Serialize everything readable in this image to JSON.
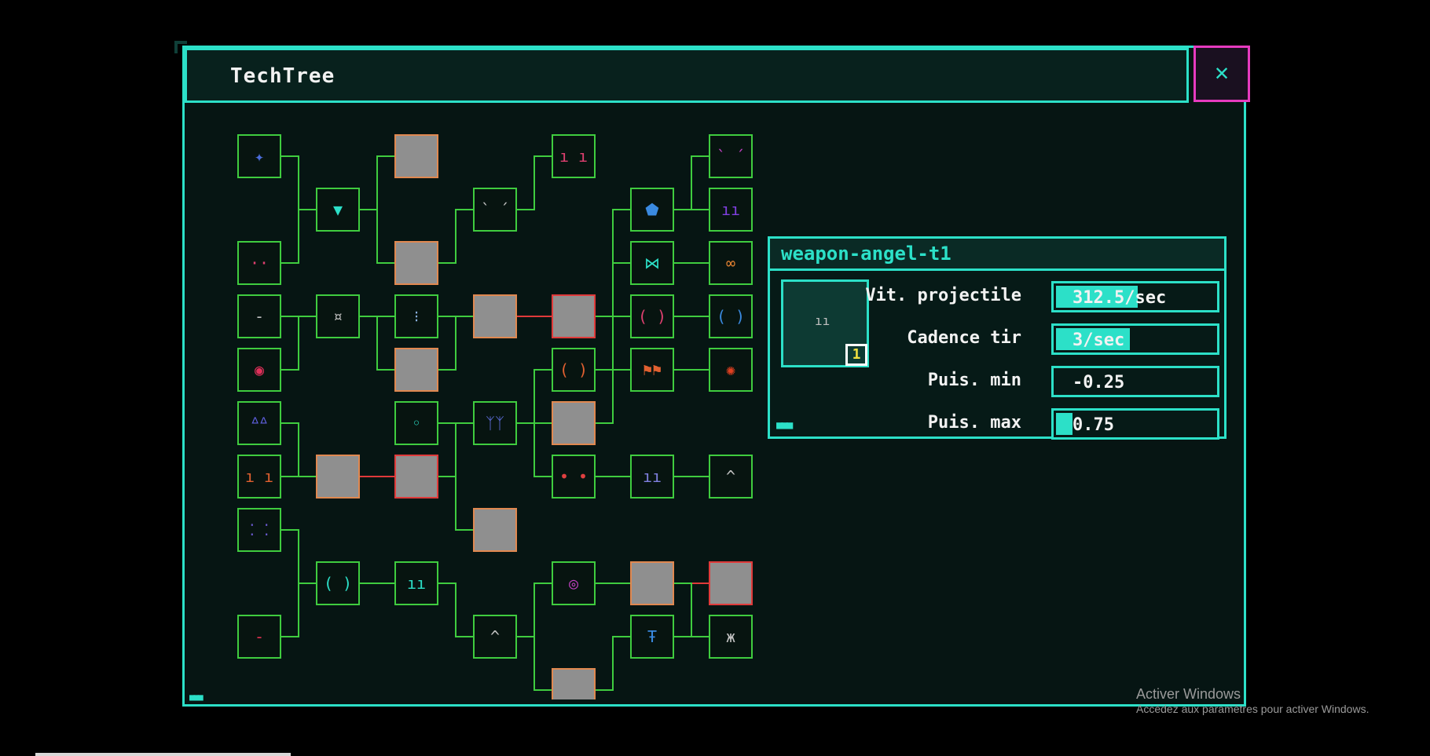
{
  "window": {
    "title": "TechTree",
    "close_label": "✕"
  },
  "info_panel": {
    "title": "weapon-angel-t1",
    "level": "1",
    "icon_glyph": "ıı",
    "stats": [
      {
        "label": "Vit. projectile",
        "value": "312.5/sec",
        "fill": 0.5
      },
      {
        "label": "Cadence tir",
        "value": "3/sec",
        "fill": 0.45
      },
      {
        "label": "Puis. min",
        "value": "-0.25",
        "fill": 0
      },
      {
        "label": "Puis. max",
        "value": "0.75",
        "fill": 0.1
      }
    ]
  },
  "tree_nodes": [
    {
      "id": "n1",
      "col": 0,
      "row": 0,
      "state": "unlocked",
      "glyph": "✦",
      "color": "#4a6cd8"
    },
    {
      "id": "n2",
      "col": 0,
      "row": 2,
      "state": "unlocked",
      "glyph": "··",
      "color": "#e04070"
    },
    {
      "id": "n3",
      "col": 0,
      "row": 3,
      "state": "unlocked",
      "glyph": "-",
      "color": "#c0c0c0"
    },
    {
      "id": "n4",
      "col": 0,
      "row": 4,
      "state": "unlocked",
      "glyph": "◉",
      "color": "#e0305a"
    },
    {
      "id": "n5",
      "col": 0,
      "row": 5,
      "state": "unlocked",
      "glyph": "ᐞᐞ",
      "color": "#6060e0"
    },
    {
      "id": "n6",
      "col": 0,
      "row": 6,
      "state": "unlocked",
      "glyph": "ı ı",
      "color": "#e06030"
    },
    {
      "id": "n7",
      "col": 0,
      "row": 7,
      "state": "unlocked",
      "glyph": "⁚ ⁚",
      "color": "#6a5ad0"
    },
    {
      "id": "n8",
      "col": 0,
      "row": 9,
      "state": "unlocked",
      "glyph": "-",
      "color": "#e03050"
    },
    {
      "id": "n9",
      "col": 1,
      "row": 1,
      "state": "unlocked",
      "glyph": "▼",
      "color": "#2ce0c8"
    },
    {
      "id": "n10",
      "col": 1,
      "row": 3,
      "state": "unlocked",
      "glyph": "¤",
      "color": "#c0c0c0"
    },
    {
      "id": "n11",
      "col": 1,
      "row": 6,
      "state": "locked",
      "glyph": "",
      "color": ""
    },
    {
      "id": "n12",
      "col": 1,
      "row": 8,
      "state": "unlocked",
      "glyph": "( )",
      "color": "#2ce0c8"
    },
    {
      "id": "n13",
      "col": 2,
      "row": 0,
      "state": "locked",
      "glyph": "",
      "color": ""
    },
    {
      "id": "n14",
      "col": 2,
      "row": 2,
      "state": "locked",
      "glyph": "",
      "color": ""
    },
    {
      "id": "n15",
      "col": 2,
      "row": 3,
      "state": "unlocked",
      "glyph": "⁝",
      "color": "#8ab0e0"
    },
    {
      "id": "n16",
      "col": 2,
      "row": 4,
      "state": "locked",
      "glyph": "",
      "color": ""
    },
    {
      "id": "n17",
      "col": 2,
      "row": 5,
      "state": "unlocked",
      "glyph": "◦",
      "color": "#2ce0c8"
    },
    {
      "id": "n18",
      "col": 2,
      "row": 6,
      "state": "locked-red",
      "glyph": "",
      "color": ""
    },
    {
      "id": "n19",
      "col": 2,
      "row": 8,
      "state": "unlocked",
      "glyph": "ıı",
      "color": "#2ce0c8"
    },
    {
      "id": "n20",
      "col": 3,
      "row": 1,
      "state": "unlocked",
      "glyph": "` ´",
      "color": "#c0c0c0"
    },
    {
      "id": "n21",
      "col": 3,
      "row": 3,
      "state": "locked",
      "glyph": "",
      "color": ""
    },
    {
      "id": "n22",
      "col": 3,
      "row": 5,
      "state": "unlocked",
      "glyph": "ᛉᛉ",
      "color": "#6070e0"
    },
    {
      "id": "n23",
      "col": 3,
      "row": 7,
      "state": "locked",
      "glyph": "",
      "color": ""
    },
    {
      "id": "n24",
      "col": 3,
      "row": 9,
      "state": "unlocked",
      "glyph": "^",
      "color": "#c0c0c0"
    },
    {
      "id": "n25",
      "col": 4,
      "row": 0,
      "state": "unlocked",
      "glyph": "ı ı",
      "color": "#e04070"
    },
    {
      "id": "n26",
      "col": 4,
      "row": 3,
      "state": "locked-red",
      "glyph": "",
      "color": ""
    },
    {
      "id": "n27",
      "col": 4,
      "row": 4,
      "state": "unlocked",
      "glyph": "( )",
      "color": "#e06030"
    },
    {
      "id": "n28",
      "col": 4,
      "row": 5,
      "state": "locked",
      "glyph": "",
      "color": ""
    },
    {
      "id": "n29",
      "col": 4,
      "row": 6,
      "state": "unlocked",
      "glyph": "• •",
      "color": "#e04040"
    },
    {
      "id": "n30",
      "col": 4,
      "row": 8,
      "state": "unlocked",
      "glyph": "◎",
      "color": "#c040c0"
    },
    {
      "id": "n31",
      "col": 4,
      "row": 10,
      "state": "locked",
      "glyph": "",
      "color": ""
    },
    {
      "id": "n32",
      "col": 5,
      "row": 1,
      "state": "unlocked",
      "glyph": "⬟",
      "color": "#3a8ae0"
    },
    {
      "id": "n33",
      "col": 5,
      "row": 2,
      "state": "unlocked",
      "glyph": "⋈",
      "color": "#2ce0c8"
    },
    {
      "id": "n34",
      "col": 5,
      "row": 3,
      "state": "unlocked",
      "glyph": "( )",
      "color": "#e04070"
    },
    {
      "id": "n35",
      "col": 5,
      "row": 4,
      "state": "unlocked",
      "glyph": "⚑⚑",
      "color": "#e06030"
    },
    {
      "id": "n36",
      "col": 5,
      "row": 6,
      "state": "unlocked",
      "glyph": "ıı",
      "color": "#8080e0"
    },
    {
      "id": "n37",
      "col": 5,
      "row": 8,
      "state": "locked",
      "glyph": "",
      "color": ""
    },
    {
      "id": "n38",
      "col": 5,
      "row": 9,
      "state": "unlocked",
      "glyph": "Ŧ",
      "color": "#3a8ae0"
    },
    {
      "id": "n39",
      "col": 6,
      "row": 0,
      "state": "unlocked",
      "glyph": "` ´",
      "color": "#c040c0"
    },
    {
      "id": "n40",
      "col": 6,
      "row": 1,
      "state": "unlocked",
      "glyph": "ıı",
      "color": "#8040e0"
    },
    {
      "id": "n41",
      "col": 6,
      "row": 2,
      "state": "unlocked",
      "glyph": "∞",
      "color": "#e08030"
    },
    {
      "id": "n42",
      "col": 6,
      "row": 3,
      "state": "unlocked",
      "glyph": "( )",
      "color": "#3a8ae0"
    },
    {
      "id": "n43",
      "col": 6,
      "row": 4,
      "state": "unlocked",
      "glyph": "✺",
      "color": "#e04020"
    },
    {
      "id": "n44",
      "col": 6,
      "row": 6,
      "state": "unlocked",
      "glyph": "^",
      "color": "#c0c0c0"
    },
    {
      "id": "n45",
      "col": 6,
      "row": 8,
      "state": "locked-red",
      "glyph": "",
      "color": ""
    },
    {
      "id": "n46",
      "col": 6,
      "row": 9,
      "state": "unlocked",
      "glyph": "ж",
      "color": "#c0c0c0"
    }
  ],
  "tree_links": [
    [
      "n1",
      "n9"
    ],
    [
      "n2",
      "n9"
    ],
    [
      "n9",
      "n13"
    ],
    [
      "n9",
      "n14"
    ],
    [
      "n3",
      "n10"
    ],
    [
      "n10",
      "n15"
    ],
    [
      "n10",
      "n16"
    ],
    [
      "n4",
      "n10"
    ],
    [
      "n14",
      "n20"
    ],
    [
      "n15",
      "n21"
    ],
    [
      "n16",
      "n21"
    ],
    [
      "n20",
      "n25"
    ],
    [
      "n21",
      "n26",
      "red"
    ],
    [
      "n26",
      "n32"
    ],
    [
      "n26",
      "n33"
    ],
    [
      "n26",
      "n34"
    ],
    [
      "n26",
      "n35"
    ],
    [
      "n32",
      "n39"
    ],
    [
      "n32",
      "n40"
    ],
    [
      "n33",
      "n41"
    ],
    [
      "n34",
      "n42"
    ],
    [
      "n35",
      "n43"
    ],
    [
      "n5",
      "n11"
    ],
    [
      "n6",
      "n11"
    ],
    [
      "n11",
      "n18",
      "red"
    ],
    [
      "n18",
      "n22"
    ],
    [
      "n17",
      "n22"
    ],
    [
      "n18",
      "n23"
    ],
    [
      "n22",
      "n27"
    ],
    [
      "n22",
      "n28"
    ],
    [
      "n22",
      "n29"
    ],
    [
      "n27",
      "n34"
    ],
    [
      "n28",
      "n35"
    ],
    [
      "n29",
      "n36"
    ],
    [
      "n36",
      "n44"
    ],
    [
      "n7",
      "n12"
    ],
    [
      "n8",
      "n12"
    ],
    [
      "n12",
      "n19"
    ],
    [
      "n19",
      "n24"
    ],
    [
      "n24",
      "n30"
    ],
    [
      "n24",
      "n31"
    ],
    [
      "n30",
      "n37"
    ],
    [
      "n37",
      "n45",
      "red"
    ],
    [
      "n31",
      "n38"
    ],
    [
      "n38",
      "n46"
    ],
    [
      "n37",
      "n46"
    ]
  ],
  "watermark": {
    "line1": "Activer Windows",
    "line2": "Accédez aux paramètres pour activer Windows."
  }
}
